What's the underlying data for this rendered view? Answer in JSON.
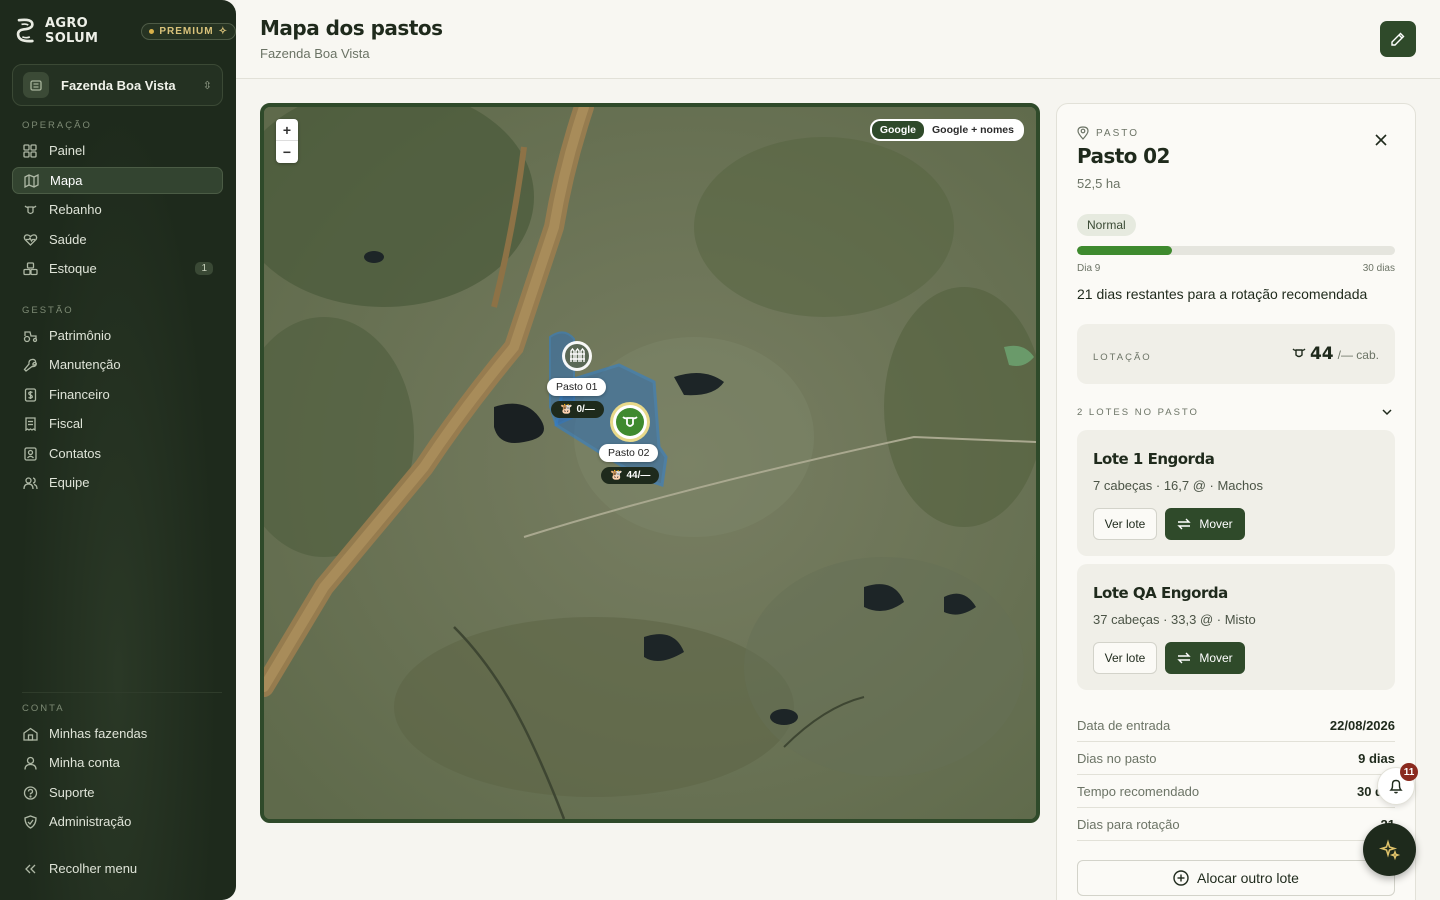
{
  "brand": {
    "name": "AGRO SOLUM",
    "plan": "PREMIUM"
  },
  "farm_selector": {
    "value": "Fazenda Boa Vista"
  },
  "nav": {
    "section_operacao": "OPERAÇÃO",
    "section_gestao": "GESTÃO",
    "section_conta": "CONTA",
    "painel": "Painel",
    "mapa": "Mapa",
    "rebanho": "Rebanho",
    "saude": "Saúde",
    "estoque": "Estoque",
    "estoque_badge": "1",
    "patrimonio": "Patrimônio",
    "manutencao": "Manutenção",
    "financeiro": "Financeiro",
    "fiscal": "Fiscal",
    "contatos": "Contatos",
    "equipe": "Equipe",
    "minhas_fazendas": "Minhas fazendas",
    "minha_conta": "Minha conta",
    "suporte": "Suporte",
    "administracao": "Administração",
    "recolher": "Recolher menu"
  },
  "header": {
    "title": "Mapa dos pastos",
    "subtitle": "Fazenda Boa Vista"
  },
  "map": {
    "zoom_in": "+",
    "zoom_out": "−",
    "layer_google": "Google",
    "layer_google_names": "Google + nomes",
    "active_layer": "Google",
    "pastures": [
      {
        "label": "Pasto 01",
        "count": "0/—"
      },
      {
        "label": "Pasto 02",
        "count": "44/—"
      }
    ]
  },
  "panel": {
    "kicker": "PASTO",
    "title": "Pasto 02",
    "area": "52,5 ha",
    "status": "Normal",
    "progress_fraction": 0.3,
    "progress_start": "Dia 9",
    "progress_end": "30 dias",
    "remaining_text": "21 dias restantes para a rotação recomendada",
    "lotacao_label": "LOTAÇÃO",
    "lotacao_value": "44",
    "lotacao_unit": "/— cab.",
    "lotes_header": "2 LOTES NO PASTO",
    "lotes": [
      {
        "name": "Lote 1 Engorda",
        "info": "7 cabeças · 16,7 @ · Machos",
        "ver": "Ver lote",
        "mover": "Mover"
      },
      {
        "name": "Lote QA Engorda",
        "info": "37 cabeças · 33,3 @ · Misto",
        "ver": "Ver lote",
        "mover": "Mover"
      }
    ],
    "details": [
      {
        "k": "Data de entrada",
        "v": "22/08/2026"
      },
      {
        "k": "Dias no pasto",
        "v": "9 dias"
      },
      {
        "k": "Tempo recomendado",
        "v": "30 d"
      },
      {
        "k": "Dias para rotação",
        "v": "21"
      }
    ],
    "alloc_button": "Alocar outro lote"
  },
  "notifications": {
    "count": "11"
  },
  "colors": {
    "sidebar": "#1e2a1c",
    "accent": "#2f4a2a",
    "progress": "#3e8a2e",
    "badge": "#8a2a1e"
  }
}
